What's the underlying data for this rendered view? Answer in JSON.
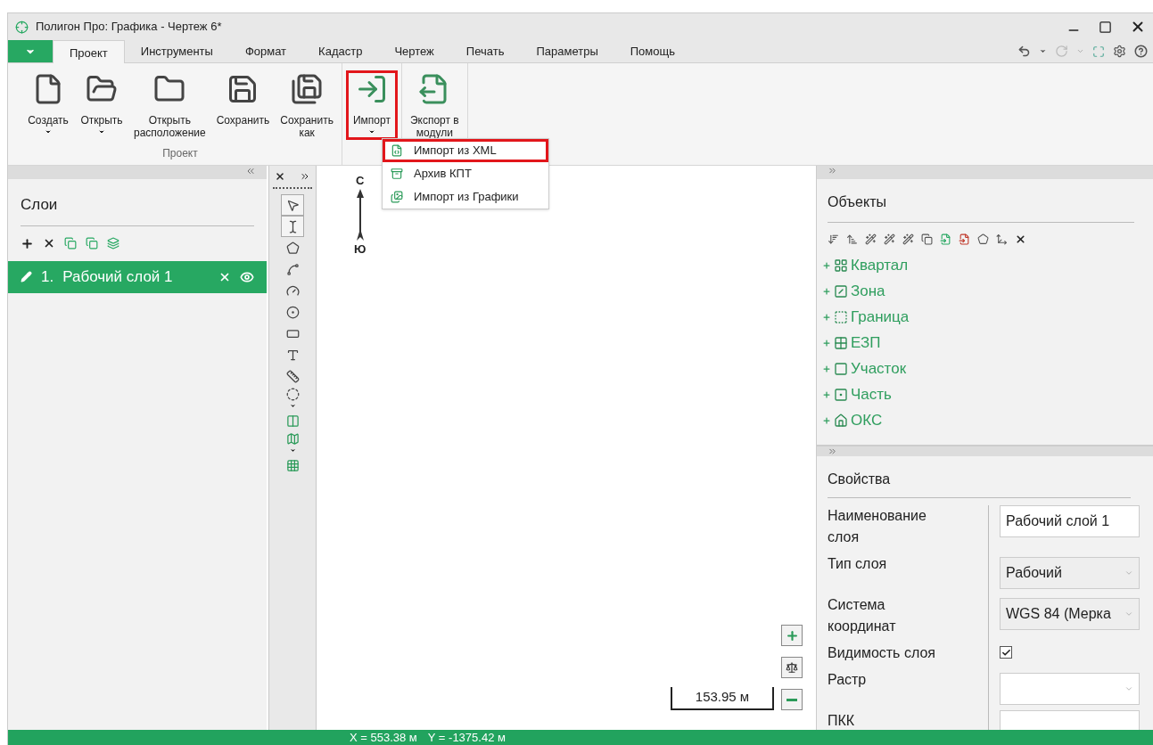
{
  "window": {
    "title": "Полигон Про: Графика - Чертеж 6*"
  },
  "tabs": [
    {
      "label": "Проект",
      "selected": true
    },
    {
      "label": "Инструменты",
      "selected": false
    },
    {
      "label": "Формат",
      "selected": false
    },
    {
      "label": "Кадастр",
      "selected": false
    },
    {
      "label": "Чертеж",
      "selected": false
    },
    {
      "label": "Печать",
      "selected": false
    },
    {
      "label": "Параметры",
      "selected": false
    },
    {
      "label": "Помощь",
      "selected": false
    }
  ],
  "ribbon": {
    "groups": [
      {
        "label": "Проект",
        "buttons": [
          {
            "label": "Создать",
            "has_dropdown": true,
            "highlighted": false
          },
          {
            "label": "Открыть",
            "has_dropdown": true,
            "highlighted": false
          },
          {
            "label": "Открыть\nрасположение",
            "has_dropdown": false,
            "highlighted": false
          },
          {
            "label": "Сохранить",
            "has_dropdown": false,
            "highlighted": false
          },
          {
            "label": "Сохранить\nкак",
            "has_dropdown": false,
            "highlighted": false
          }
        ]
      },
      {
        "buttons": [
          {
            "label": "Импорт",
            "has_dropdown": true,
            "highlighted": true
          }
        ]
      },
      {
        "buttons": [
          {
            "label": "Экспорт в\nмодули",
            "has_dropdown": false,
            "highlighted": false
          }
        ]
      }
    ]
  },
  "dropdown_menu": [
    {
      "label": "Импорт из XML",
      "highlighted": true
    },
    {
      "label": "Архив КПТ",
      "highlighted": false
    },
    {
      "label": "Импорт из Графики",
      "highlighted": false
    }
  ],
  "layers_panel": {
    "title": "Слои",
    "layers": [
      {
        "number": "1.",
        "name": "Рабочий слой 1",
        "selected": true,
        "visible": true
      }
    ]
  },
  "toolbox": {
    "tools": [
      {
        "selected": true,
        "has_dropdown": false
      },
      {
        "selected": true,
        "has_dropdown": false
      },
      {
        "selected": false,
        "has_dropdown": false
      },
      {
        "selected": false,
        "has_dropdown": false
      },
      {
        "selected": false,
        "has_dropdown": false
      },
      {
        "selected": false,
        "has_dropdown": false
      },
      {
        "selected": false,
        "has_dropdown": false
      },
      {
        "selected": false,
        "has_dropdown": false
      },
      {
        "selected": false,
        "has_dropdown": false
      },
      {
        "selected": false,
        "has_dropdown": true
      },
      {
        "selected": false,
        "has_dropdown": false
      },
      {
        "selected": false,
        "has_dropdown": true
      },
      {
        "selected": false,
        "has_dropdown": false
      }
    ]
  },
  "canvas": {
    "north": "С",
    "south": "Ю",
    "scale": "153.95 м"
  },
  "objects_panel": {
    "title": "Объекты",
    "items": [
      {
        "label": "Квартал",
        "expanded": false
      },
      {
        "label": "Зона",
        "expanded": false
      },
      {
        "label": "Граница",
        "expanded": false
      },
      {
        "label": "ЕЗП",
        "expanded": false
      },
      {
        "label": "Участок",
        "expanded": false
      },
      {
        "label": "Часть",
        "expanded": false
      },
      {
        "label": "ОКС",
        "expanded": false
      }
    ]
  },
  "properties_panel": {
    "title": "Свойства",
    "rows": [
      {
        "label": "Наименование слоя",
        "kind": "text",
        "value": "Рабочий слой 1"
      },
      {
        "label": "Тип слоя",
        "kind": "select",
        "value": "Рабочий",
        "disabled": true
      },
      {
        "label": "Система координат",
        "kind": "select",
        "value": "WGS 84 (Мерка",
        "disabled": true
      },
      {
        "label": "Видимость слоя",
        "kind": "checkbox",
        "checked": true
      },
      {
        "label": "Растр",
        "kind": "select",
        "value": "",
        "disabled": false
      },
      {
        "label": "ПКК",
        "kind": "text",
        "value": ""
      }
    ]
  },
  "status_bar": {
    "x": "X = 553.38 м",
    "y": "Y = -1375.42 м"
  }
}
